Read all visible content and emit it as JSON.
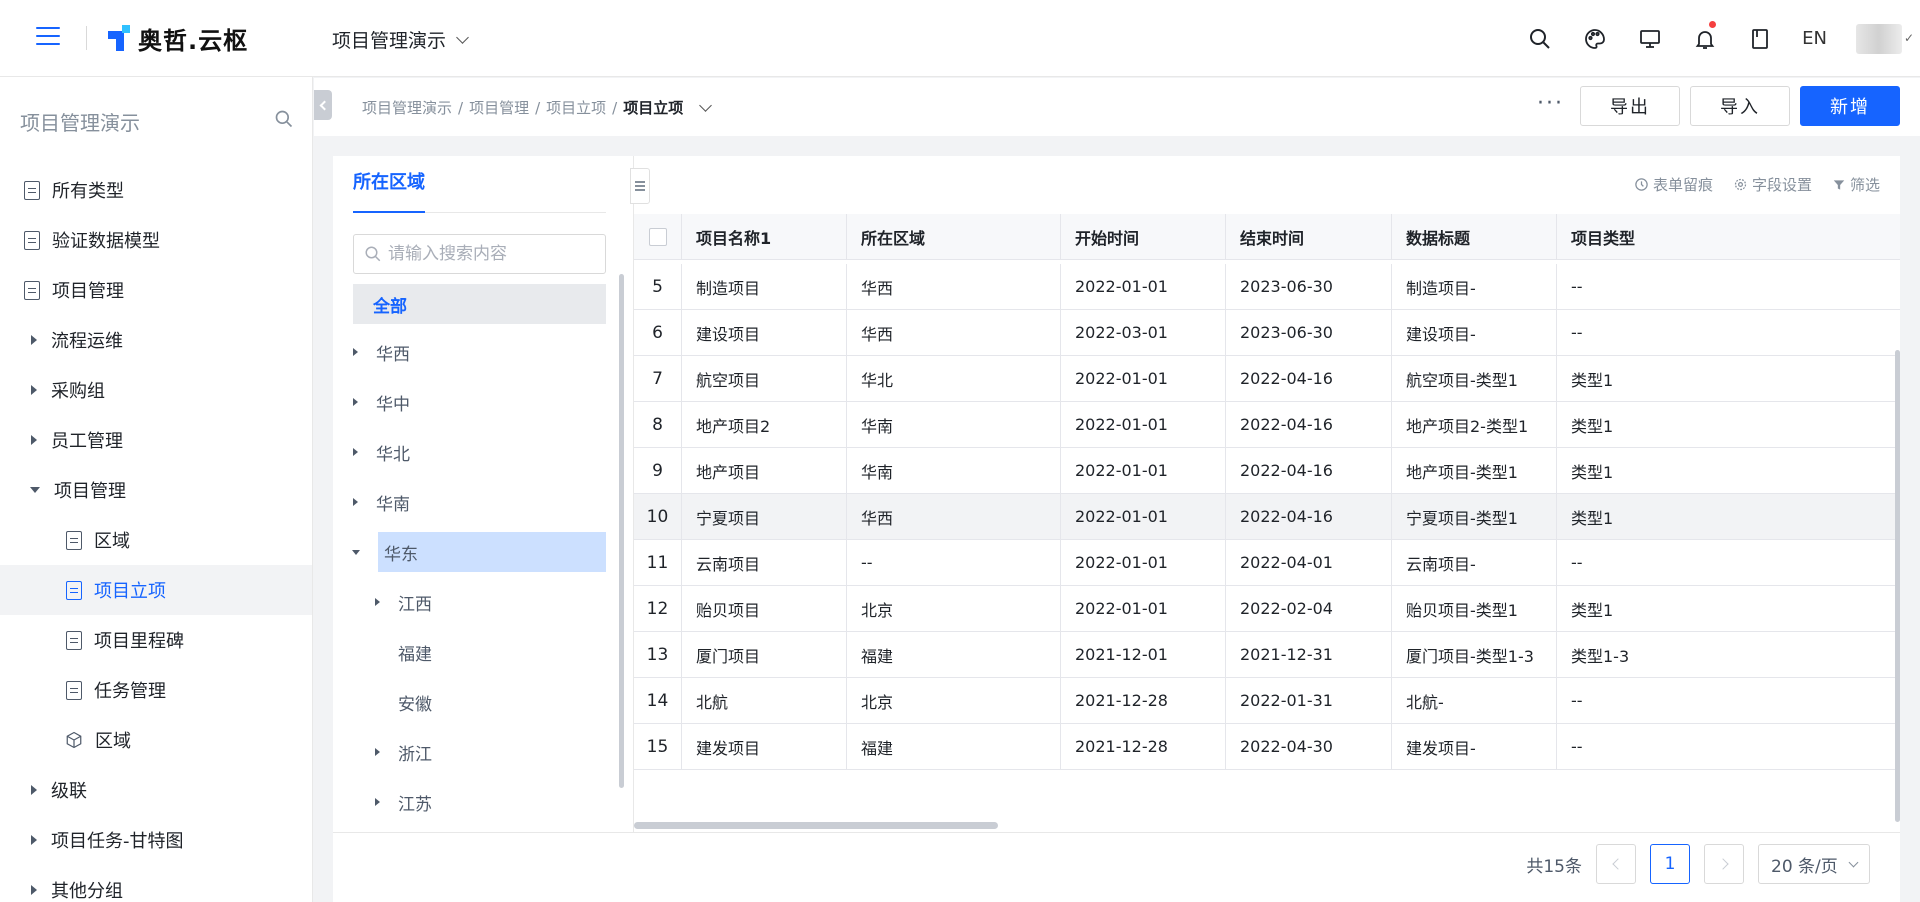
{
  "header": {
    "logo_text": "奥哲.云枢",
    "project_name": "项目管理演示",
    "lang": "EN",
    "icons": [
      "search-icon",
      "palette-icon",
      "monitor-icon",
      "bell-icon",
      "book-icon"
    ]
  },
  "sidebar": {
    "title": "项目管理演示",
    "items": [
      {
        "label": "所有类型",
        "icon": "doc-icon"
      },
      {
        "label": "验证数据模型",
        "icon": "doc-icon"
      },
      {
        "label": "项目管理",
        "icon": "doc-icon"
      },
      {
        "label": "流程运维",
        "icon": "caret-right-icon"
      },
      {
        "label": "采购组",
        "icon": "caret-right-icon"
      },
      {
        "label": "员工管理",
        "icon": "caret-right-icon"
      },
      {
        "label": "项目管理",
        "icon": "caret-down-icon"
      },
      {
        "label": "区域",
        "icon": "doc-icon"
      },
      {
        "label": "项目立项",
        "icon": "doc-icon",
        "active": true
      },
      {
        "label": "项目里程碑",
        "icon": "doc-icon"
      },
      {
        "label": "任务管理",
        "icon": "doc-icon"
      },
      {
        "label": "区域",
        "icon": "cube-icon"
      },
      {
        "label": "级联",
        "icon": "caret-right-icon"
      },
      {
        "label": "项目任务-甘特图",
        "icon": "caret-right-icon"
      },
      {
        "label": "其他分组",
        "icon": "caret-right-icon"
      }
    ]
  },
  "breadcrumb": {
    "items": [
      "项目管理演示",
      "/",
      "项目管理",
      "/",
      "项目立项",
      "/"
    ],
    "current": "项目立项"
  },
  "actions": {
    "more": "···",
    "export": "导出",
    "import": "导入",
    "add": "新增"
  },
  "tree": {
    "tab": "所在区域",
    "search_placeholder": "请输入搜索内容",
    "all": "全部",
    "nodes": [
      {
        "label": "华西",
        "expand": "collapsed"
      },
      {
        "label": "华中",
        "expand": "collapsed"
      },
      {
        "label": "华北",
        "expand": "collapsed"
      },
      {
        "label": "华南",
        "expand": "collapsed"
      },
      {
        "label": "华东",
        "expand": "expanded",
        "selected": true
      },
      {
        "label": "江西",
        "expand": "collapsed",
        "child": true
      },
      {
        "label": "福建",
        "expand": "leaf",
        "child": true
      },
      {
        "label": "安徽",
        "expand": "leaf",
        "child": true
      },
      {
        "label": "浙江",
        "expand": "collapsed",
        "child": true
      },
      {
        "label": "江苏",
        "expand": "collapsed",
        "child": true
      }
    ]
  },
  "table": {
    "tools": {
      "trace": "表单留痕",
      "fields": "字段设置",
      "filter": "筛选"
    },
    "columns": [
      "项目名称1",
      "所在区域",
      "开始时间",
      "结束时间",
      "数据标题",
      "项目类型"
    ],
    "rows": [
      {
        "index": "5",
        "name": "制造项目",
        "region": "华西",
        "start": "2022-01-01",
        "end": "2023-06-30",
        "title": "制造项目-",
        "type": "--"
      },
      {
        "index": "6",
        "name": "建设项目",
        "region": "华西",
        "start": "2022-03-01",
        "end": "2023-06-30",
        "title": "建设项目-",
        "type": "--"
      },
      {
        "index": "7",
        "name": "航空项目",
        "region": "华北",
        "start": "2022-01-01",
        "end": "2022-04-16",
        "title": "航空项目-类型1",
        "type": "类型1"
      },
      {
        "index": "8",
        "name": "地产项目2",
        "region": "华南",
        "start": "2022-01-01",
        "end": "2022-04-16",
        "title": "地产项目2-类型1",
        "type": "类型1"
      },
      {
        "index": "9",
        "name": "地产项目",
        "region": "华南",
        "start": "2022-01-01",
        "end": "2022-04-16",
        "title": "地产项目-类型1",
        "type": "类型1"
      },
      {
        "index": "10",
        "name": "宁夏项目",
        "region": "华西",
        "start": "2022-01-01",
        "end": "2022-04-16",
        "title": "宁夏项目-类型1",
        "type": "类型1",
        "highlight": true
      },
      {
        "index": "11",
        "name": "云南项目",
        "region": "--",
        "start": "2022-01-01",
        "end": "2022-04-01",
        "title": "云南项目-",
        "type": "--"
      },
      {
        "index": "12",
        "name": "贻贝项目",
        "region": "北京",
        "start": "2022-01-01",
        "end": "2022-02-04",
        "title": "贻贝项目-类型1",
        "type": "类型1"
      },
      {
        "index": "13",
        "name": "厦门项目",
        "region": "福建",
        "start": "2021-12-01",
        "end": "2021-12-31",
        "title": "厦门项目-类型1-3",
        "type": "类型1-3"
      },
      {
        "index": "14",
        "name": "北航",
        "region": "北京",
        "start": "2021-12-28",
        "end": "2022-01-31",
        "title": "北航-",
        "type": "--"
      },
      {
        "index": "15",
        "name": "建发项目",
        "region": "福建",
        "start": "2021-12-28",
        "end": "2022-04-30",
        "title": "建发项目-",
        "type": "--"
      }
    ]
  },
  "pagination": {
    "total": "共15条",
    "current_page": "1",
    "page_size": "20 条/页"
  },
  "colors": {
    "primary": "#1664ff",
    "tree_selected": "#cce0ff",
    "row_highlight": "#f2f3f5"
  }
}
